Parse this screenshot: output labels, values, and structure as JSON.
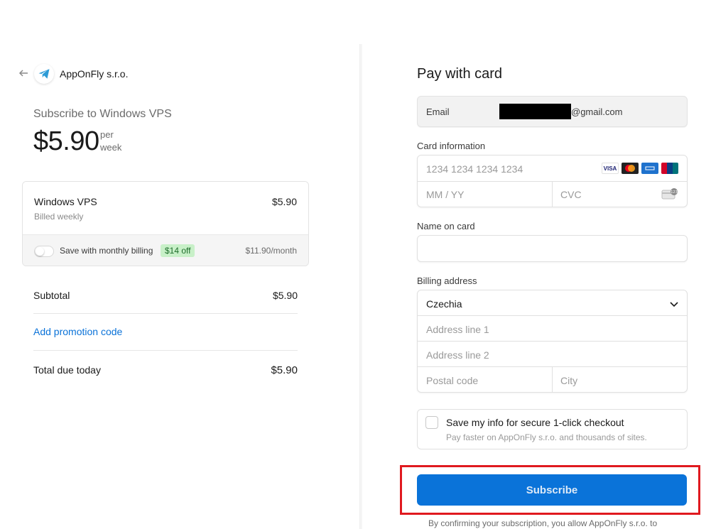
{
  "merchant": {
    "name": "AppOnFly s.r.o."
  },
  "summary": {
    "subscribe_label": "Subscribe to Windows VPS",
    "price": "$5.90",
    "per_line1": "per",
    "per_line2": "week"
  },
  "plan": {
    "name": "Windows VPS",
    "billing": "Billed weekly",
    "price": "$5.90",
    "toggle_label": "Save with monthly billing",
    "badge": "$14 off",
    "monthly_price": "$11.90/month"
  },
  "totals": {
    "subtotal_label": "Subtotal",
    "subtotal_value": "$5.90",
    "promo_label": "Add promotion code",
    "total_label": "Total due today",
    "total_value": "$5.90"
  },
  "payment": {
    "title": "Pay with card",
    "email_label": "Email",
    "email_domain": "@gmail.com",
    "card_info_label": "Card information",
    "card_number_placeholder": "1234 1234 1234 1234",
    "expiry_placeholder": "MM / YY",
    "cvc_placeholder": "CVC",
    "brands": [
      "VISA",
      "Mastercard",
      "Amex",
      "UnionPay"
    ],
    "name_label": "Name on card",
    "name_value": "",
    "billing_label": "Billing address",
    "country": "Czechia",
    "address1_placeholder": "Address line 1",
    "address2_placeholder": "Address line 2",
    "postal_placeholder": "Postal code",
    "city_placeholder": "City",
    "save_title": "Save my info for secure 1-click checkout",
    "save_sub": "Pay faster on AppOnFly s.r.o. and thousands of sites.",
    "subscribe_label": "Subscribe",
    "confirm_text": "By confirming your subscription, you allow AppOnFly s.r.o. to"
  },
  "colors": {
    "accent": "#0a73d9",
    "link": "#0a72d8",
    "highlight": "#e0191f",
    "badge_bg": "#c8f0c8"
  }
}
